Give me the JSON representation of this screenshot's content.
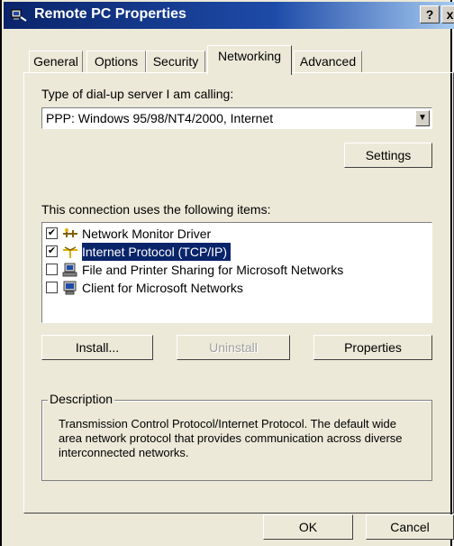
{
  "window": {
    "title": "Remote PC Properties",
    "help_label": "?",
    "close_label": "x"
  },
  "tabs": [
    {
      "label": "General"
    },
    {
      "label": "Options"
    },
    {
      "label": "Security"
    },
    {
      "label": "Networking",
      "active": true
    },
    {
      "label": "Advanced"
    }
  ],
  "networking": {
    "server_type_label": "Type of dial-up server I am calling:",
    "server_type_value": "PPP: Windows 95/98/NT4/2000, Internet",
    "settings_button": "Settings",
    "items_label": "This connection uses the following items:",
    "items": [
      {
        "label": "Network Monitor Driver",
        "checked": true,
        "icon": "network-driver-icon"
      },
      {
        "label": "Internet Protocol (TCP/IP)",
        "checked": true,
        "selected": true,
        "icon": "protocol-icon"
      },
      {
        "label": "File and Printer Sharing for Microsoft Networks",
        "checked": false,
        "icon": "file-printer-sharing-icon"
      },
      {
        "label": "Client for Microsoft Networks",
        "checked": false,
        "icon": "client-computer-icon"
      }
    ],
    "install_button": "Install...",
    "uninstall_button": "Uninstall",
    "properties_button": "Properties",
    "description_title": "Description",
    "description_text": "Transmission Control Protocol/Internet Protocol. The default wide area network protocol that provides communication across diverse interconnected networks."
  },
  "footer": {
    "ok_button": "OK",
    "cancel_button": "Cancel"
  },
  "colors": {
    "titlebar": "#0a246a",
    "selection": "#0a246a",
    "face": "#ece9d8"
  }
}
